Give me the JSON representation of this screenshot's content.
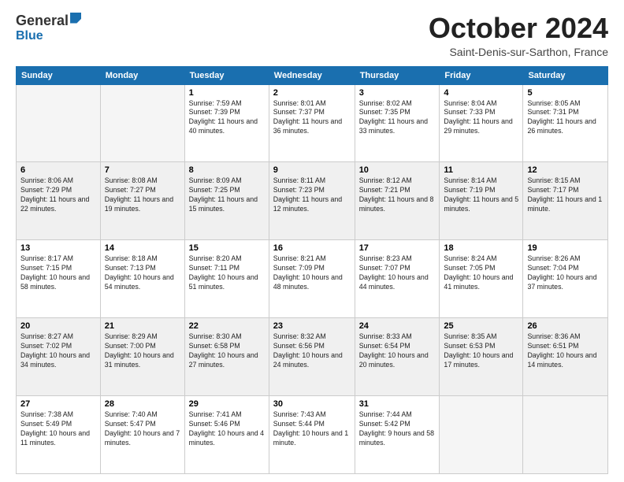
{
  "logo": {
    "general": "General",
    "blue": "Blue"
  },
  "header": {
    "month": "October 2024",
    "location": "Saint-Denis-sur-Sarthon, France"
  },
  "weekdays": [
    "Sunday",
    "Monday",
    "Tuesday",
    "Wednesday",
    "Thursday",
    "Friday",
    "Saturday"
  ],
  "weeks": [
    [
      {
        "day": "",
        "info": ""
      },
      {
        "day": "",
        "info": ""
      },
      {
        "day": "1",
        "info": "Sunrise: 7:59 AM\nSunset: 7:39 PM\nDaylight: 11 hours and 40 minutes."
      },
      {
        "day": "2",
        "info": "Sunrise: 8:01 AM\nSunset: 7:37 PM\nDaylight: 11 hours and 36 minutes."
      },
      {
        "day": "3",
        "info": "Sunrise: 8:02 AM\nSunset: 7:35 PM\nDaylight: 11 hours and 33 minutes."
      },
      {
        "day": "4",
        "info": "Sunrise: 8:04 AM\nSunset: 7:33 PM\nDaylight: 11 hours and 29 minutes."
      },
      {
        "day": "5",
        "info": "Sunrise: 8:05 AM\nSunset: 7:31 PM\nDaylight: 11 hours and 26 minutes."
      }
    ],
    [
      {
        "day": "6",
        "info": "Sunrise: 8:06 AM\nSunset: 7:29 PM\nDaylight: 11 hours and 22 minutes."
      },
      {
        "day": "7",
        "info": "Sunrise: 8:08 AM\nSunset: 7:27 PM\nDaylight: 11 hours and 19 minutes."
      },
      {
        "day": "8",
        "info": "Sunrise: 8:09 AM\nSunset: 7:25 PM\nDaylight: 11 hours and 15 minutes."
      },
      {
        "day": "9",
        "info": "Sunrise: 8:11 AM\nSunset: 7:23 PM\nDaylight: 11 hours and 12 minutes."
      },
      {
        "day": "10",
        "info": "Sunrise: 8:12 AM\nSunset: 7:21 PM\nDaylight: 11 hours and 8 minutes."
      },
      {
        "day": "11",
        "info": "Sunrise: 8:14 AM\nSunset: 7:19 PM\nDaylight: 11 hours and 5 minutes."
      },
      {
        "day": "12",
        "info": "Sunrise: 8:15 AM\nSunset: 7:17 PM\nDaylight: 11 hours and 1 minute."
      }
    ],
    [
      {
        "day": "13",
        "info": "Sunrise: 8:17 AM\nSunset: 7:15 PM\nDaylight: 10 hours and 58 minutes."
      },
      {
        "day": "14",
        "info": "Sunrise: 8:18 AM\nSunset: 7:13 PM\nDaylight: 10 hours and 54 minutes."
      },
      {
        "day": "15",
        "info": "Sunrise: 8:20 AM\nSunset: 7:11 PM\nDaylight: 10 hours and 51 minutes."
      },
      {
        "day": "16",
        "info": "Sunrise: 8:21 AM\nSunset: 7:09 PM\nDaylight: 10 hours and 48 minutes."
      },
      {
        "day": "17",
        "info": "Sunrise: 8:23 AM\nSunset: 7:07 PM\nDaylight: 10 hours and 44 minutes."
      },
      {
        "day": "18",
        "info": "Sunrise: 8:24 AM\nSunset: 7:05 PM\nDaylight: 10 hours and 41 minutes."
      },
      {
        "day": "19",
        "info": "Sunrise: 8:26 AM\nSunset: 7:04 PM\nDaylight: 10 hours and 37 minutes."
      }
    ],
    [
      {
        "day": "20",
        "info": "Sunrise: 8:27 AM\nSunset: 7:02 PM\nDaylight: 10 hours and 34 minutes."
      },
      {
        "day": "21",
        "info": "Sunrise: 8:29 AM\nSunset: 7:00 PM\nDaylight: 10 hours and 31 minutes."
      },
      {
        "day": "22",
        "info": "Sunrise: 8:30 AM\nSunset: 6:58 PM\nDaylight: 10 hours and 27 minutes."
      },
      {
        "day": "23",
        "info": "Sunrise: 8:32 AM\nSunset: 6:56 PM\nDaylight: 10 hours and 24 minutes."
      },
      {
        "day": "24",
        "info": "Sunrise: 8:33 AM\nSunset: 6:54 PM\nDaylight: 10 hours and 20 minutes."
      },
      {
        "day": "25",
        "info": "Sunrise: 8:35 AM\nSunset: 6:53 PM\nDaylight: 10 hours and 17 minutes."
      },
      {
        "day": "26",
        "info": "Sunrise: 8:36 AM\nSunset: 6:51 PM\nDaylight: 10 hours and 14 minutes."
      }
    ],
    [
      {
        "day": "27",
        "info": "Sunrise: 7:38 AM\nSunset: 5:49 PM\nDaylight: 10 hours and 11 minutes."
      },
      {
        "day": "28",
        "info": "Sunrise: 7:40 AM\nSunset: 5:47 PM\nDaylight: 10 hours and 7 minutes."
      },
      {
        "day": "29",
        "info": "Sunrise: 7:41 AM\nSunset: 5:46 PM\nDaylight: 10 hours and 4 minutes."
      },
      {
        "day": "30",
        "info": "Sunrise: 7:43 AM\nSunset: 5:44 PM\nDaylight: 10 hours and 1 minute."
      },
      {
        "day": "31",
        "info": "Sunrise: 7:44 AM\nSunset: 5:42 PM\nDaylight: 9 hours and 58 minutes."
      },
      {
        "day": "",
        "info": ""
      },
      {
        "day": "",
        "info": ""
      }
    ]
  ]
}
